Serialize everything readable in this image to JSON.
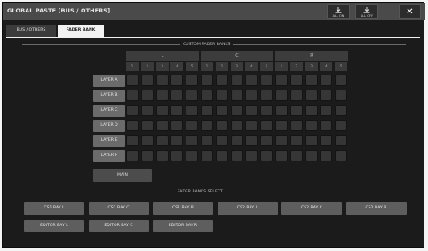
{
  "window": {
    "title": "GLOBAL PASTE [BUS / OTHERS]"
  },
  "toolbar": {
    "all_on": "ALL ON",
    "all_off": "ALL OFF",
    "close": "✕"
  },
  "tabs": [
    {
      "label": "BUS / OTHERS",
      "active": false
    },
    {
      "label": "FADER BANK",
      "active": true
    }
  ],
  "custom": {
    "title": "CUSTOM FADER BANKS",
    "groups": [
      "L",
      "C",
      "R"
    ],
    "column_numbers": [
      "1",
      "2",
      "3",
      "4",
      "5",
      "1",
      "2",
      "3",
      "4",
      "5",
      "1",
      "2",
      "3",
      "4",
      "5"
    ],
    "layers": [
      "LAYER A",
      "LAYER B",
      "LAYER C",
      "LAYER D",
      "LAYER E",
      "LAYER F"
    ],
    "main_label": "MAIN"
  },
  "select": {
    "title": "FADER BANKS SELECT",
    "row1": [
      "CS1 BAY L",
      "CS1 BAY C",
      "CS1 BAY R",
      "CS2 BAY L",
      "CS2 BAY C",
      "CS2 BAY R"
    ],
    "row2": [
      "EDITOR BAY L",
      "EDITOR BAY C",
      "EDITOR BAY R"
    ]
  }
}
